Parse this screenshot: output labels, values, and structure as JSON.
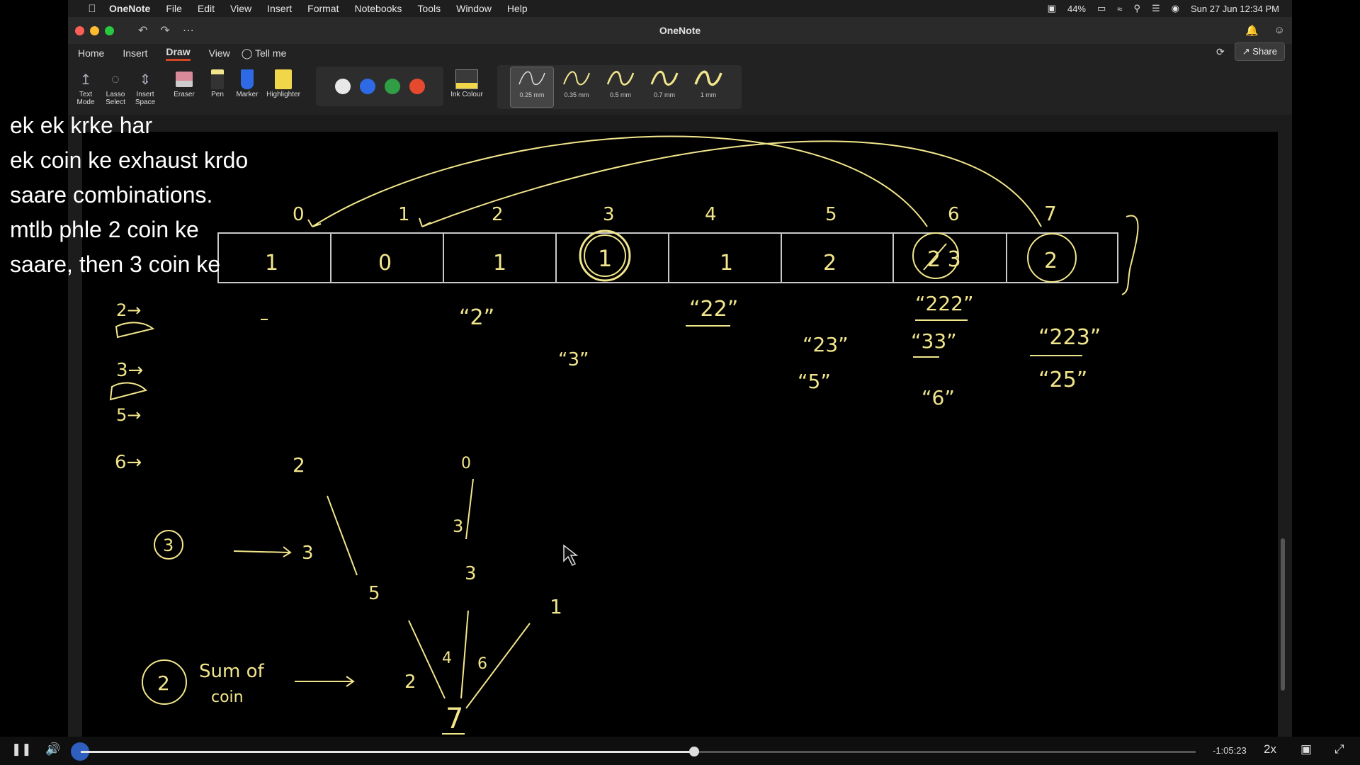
{
  "menubar": {
    "app": "OneNote",
    "items": [
      "File",
      "Edit",
      "View",
      "Insert",
      "Format",
      "Notebooks",
      "Tools",
      "Window",
      "Help"
    ],
    "battery": "44%",
    "datetime": "Sun 27 Jun  12:34 PM"
  },
  "window": {
    "title": "OneNote",
    "tabs": [
      "Home",
      "Insert",
      "Draw",
      "View"
    ],
    "active_tab": "Draw",
    "tell_me": "Tell me",
    "share": "Share"
  },
  "ribbon": {
    "text_mode": "Text Mode",
    "lasso": "Lasso Select",
    "insert_space": "Insert Space",
    "eraser": "Eraser",
    "pen": "Pen",
    "marker": "Marker",
    "highlighter": "Highlighter",
    "ink_colour": "Ink Colour",
    "colors": [
      "#e8e8e8",
      "#2f6ae6",
      "#2f9e45",
      "#e64a2e"
    ],
    "pen_sizes": [
      "0.25 mm",
      "0.35 mm",
      "0.5 mm",
      "0.7 mm",
      "1 mm"
    ],
    "selected_pen": "0.25 mm"
  },
  "notes": {
    "line1": "ek ek krke har",
    "line2": "ek coin ke exhaust krdo",
    "line3": "saare combinations.",
    "line4": "mtlb phle 2 coin ke",
    "line5": "saare, then 3 coin ke"
  },
  "ink": {
    "color": "#f2e68c",
    "indices": [
      "0",
      "1",
      "2",
      "3",
      "4",
      "5",
      "6",
      "7"
    ],
    "cells": [
      "1",
      "0",
      "1",
      "1",
      "1",
      "2",
      "2 3",
      "2"
    ],
    "strings": {
      "s2": "“2”",
      "s3": "“3”",
      "s22": "“22”",
      "s23": "“23”",
      "s5": "“5”",
      "s222": "“222”",
      "s33": "“33”",
      "s6": "“6”",
      "s223": "“223”",
      "s25": "“25”"
    },
    "left_notes": [
      "2→",
      "3→",
      "5→",
      "6→"
    ],
    "tree": {
      "n3": "3",
      "n2": "2",
      "n3b": "3",
      "n5": "5",
      "n0": "0",
      "n3c": "3",
      "n3d": "3",
      "n1": "1",
      "n2b": "2",
      "n4": "4",
      "n6": "6",
      "n7": "7",
      "circle3": "3",
      "circle2": "2",
      "sum1": "Sum of",
      "sum2": "coin"
    }
  },
  "video": {
    "time_remaining": "-1:05:23",
    "speed": "2x",
    "progress": 0.55
  }
}
